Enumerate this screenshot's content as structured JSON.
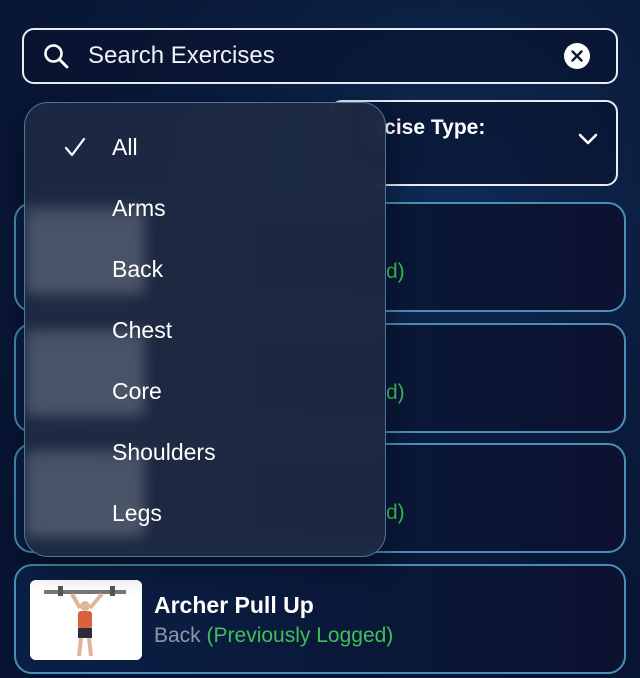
{
  "search": {
    "placeholder": "Search Exercises"
  },
  "filter": {
    "label_visible": "rcise Type:"
  },
  "cards": [
    {
      "peek": "d)"
    },
    {
      "peek": "d)"
    },
    {
      "peek": "d)"
    },
    {
      "title": "Archer Pull Up",
      "category": "Back",
      "status": "(Previously Logged)"
    }
  ],
  "menu": {
    "selected": "All",
    "items": [
      {
        "label": "All"
      },
      {
        "label": "Arms"
      },
      {
        "label": "Back"
      },
      {
        "label": "Chest"
      },
      {
        "label": "Core"
      },
      {
        "label": "Shoulders"
      },
      {
        "label": "Legs"
      }
    ]
  },
  "colors": {
    "accent_green": "#3fbf5a",
    "card_border": "#4a8fb7",
    "muted": "#8e96a8"
  },
  "icons": {
    "search": "search-icon",
    "clear": "clear-icon",
    "chevron": "chevron-down-icon",
    "check": "checkmark-icon"
  }
}
